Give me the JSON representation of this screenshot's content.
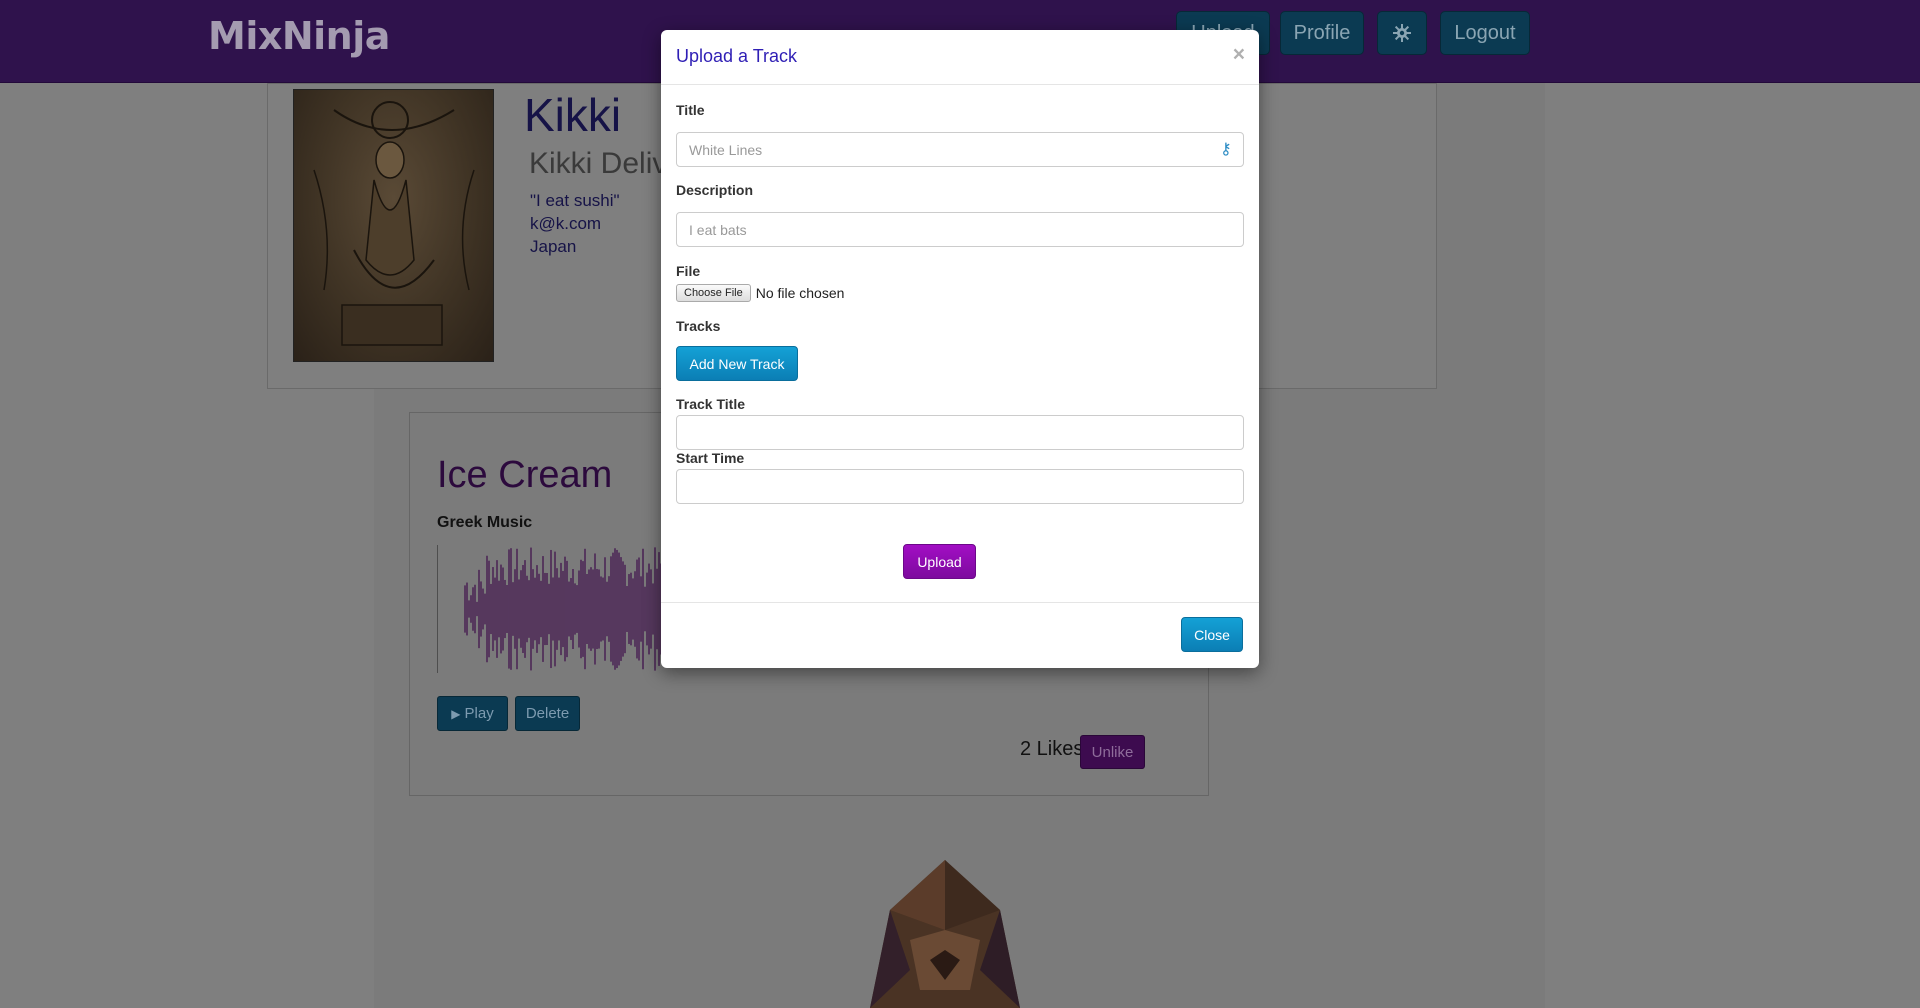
{
  "navbar": {
    "brand": "MixNinja",
    "upload_label": "Upload",
    "profile_label": "Profile",
    "settings_icon": "gear-icon",
    "logout_label": "Logout"
  },
  "profile": {
    "name": "Kikki",
    "subtitle": "Kikki Delive",
    "quote": "\"I eat sushi\"",
    "email": "k@k.com",
    "location": "Japan"
  },
  "track": {
    "title": "Ice Cream",
    "genre": "Greek Music",
    "play_label": "Play",
    "play_icon": "play-icon",
    "delete_label": "Delete",
    "likes": "2 Likes",
    "unlike_label": "Unlike"
  },
  "modal": {
    "title": "Upload a Track",
    "close_glyph": "×",
    "title_label": "Title",
    "title_placeholder": "White Lines",
    "description_label": "Description",
    "description_placeholder": "I eat bats",
    "file_label": "File",
    "choose_file_label": "Choose File",
    "file_status": "No file chosen",
    "tracks_label": "Tracks",
    "add_track_label": "Add New Track",
    "track_title_label": "Track Title",
    "start_time_label": "Start Time",
    "upload_label": "Upload",
    "close_label": "Close"
  },
  "colors": {
    "navbar": "#4b1d79",
    "accent_blue": "#0b89c3",
    "accent_purple": "#9a0dbd",
    "overlay": "#000000"
  }
}
